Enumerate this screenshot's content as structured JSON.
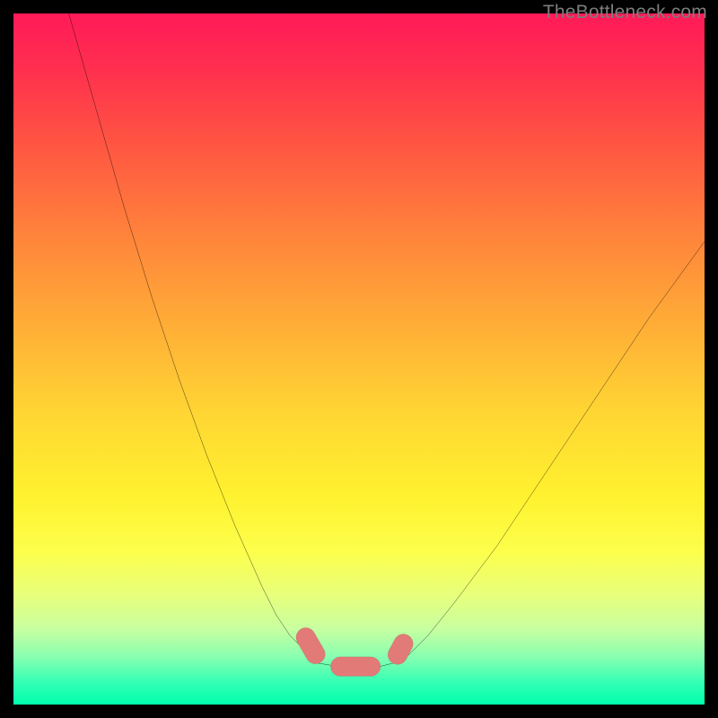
{
  "watermark": "TheBottleneck.com",
  "colors": {
    "frame": "#000000",
    "gradient_top": "#ff1a58",
    "gradient_mid": "#ffd633",
    "gradient_bottom": "#00ffad",
    "curve_stroke": "#000000",
    "marker_fill": "#e27a77",
    "marker_stroke": "#9d4a45"
  },
  "chart_data": {
    "type": "line",
    "title": "",
    "xlabel": "",
    "ylabel": "",
    "xlim": [
      0,
      100
    ],
    "ylim": [
      0,
      100
    ],
    "note": "Axes and gridlines are not drawn; values are approximate positions read from the image (percent of plot area, y measured from top).",
    "grid": false,
    "legend": false,
    "series": [
      {
        "name": "left-curve",
        "x": [
          8,
          12,
          16,
          20,
          24,
          28,
          32,
          36,
          38,
          40,
          42,
          43,
          44
        ],
        "y": [
          0,
          14,
          28,
          41,
          53,
          64,
          74,
          83,
          87,
          90,
          92,
          93,
          94
        ]
      },
      {
        "name": "right-curve",
        "x": [
          55,
          57,
          60,
          64,
          70,
          76,
          84,
          92,
          100
        ],
        "y": [
          94,
          93,
          90,
          85,
          77,
          68,
          56,
          44,
          33
        ]
      },
      {
        "name": "bottom-flat",
        "x": [
          44,
          47,
          50,
          53,
          55
        ],
        "y": [
          94,
          94.5,
          94.5,
          94.5,
          94
        ]
      }
    ],
    "markers": [
      {
        "shape": "capsule",
        "cx": 43.0,
        "cy": 91.5,
        "rx": 1.4,
        "ry": 2.8,
        "angle": -30
      },
      {
        "shape": "capsule",
        "cx": 49.5,
        "cy": 94.5,
        "rx": 3.6,
        "ry": 1.4,
        "angle": 0
      },
      {
        "shape": "capsule",
        "cx": 56.0,
        "cy": 92.0,
        "rx": 1.4,
        "ry": 2.3,
        "angle": 28
      }
    ]
  }
}
